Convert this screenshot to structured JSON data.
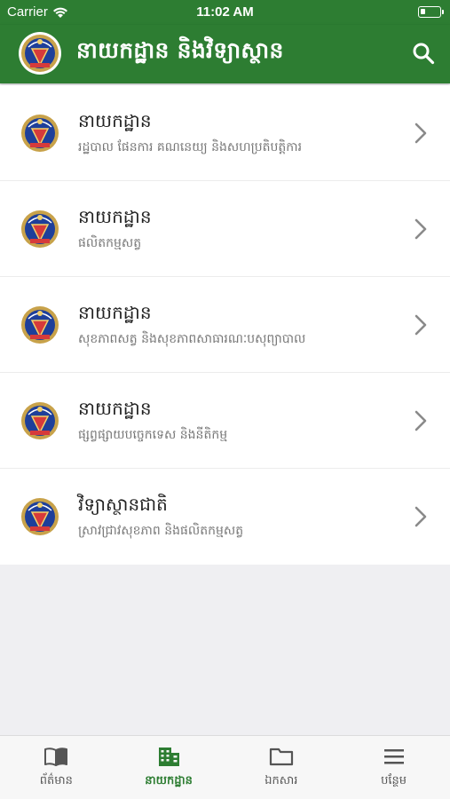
{
  "status_bar": {
    "carrier": "Carrier",
    "time": "11:02 AM"
  },
  "header": {
    "title": "នាយកដ្ឋាន និងវិទ្យាស្ថាន",
    "search_icon": "search-icon"
  },
  "items": [
    {
      "title": "នាយកដ្ឋាន",
      "subtitle": "រដ្ឋបាល ផែនការ គណនេយ្យ និងសហប្រតិបត្តិការ"
    },
    {
      "title": "នាយកដ្ឋាន",
      "subtitle": "ផលិតកម្មសត្វ"
    },
    {
      "title": "នាយកដ្ឋាន",
      "subtitle": "សុខភាពសត្វ និងសុខភាពសាធារណៈបសុព្យាបាល"
    },
    {
      "title": "នាយកដ្ឋាន",
      "subtitle": "ផ្សព្វផ្សាយបច្ចេកទេស និងនីតិកម្ម"
    },
    {
      "title": "វិទ្យាស្ថានជាតិ",
      "subtitle": "ស្រាវជ្រាវសុខភាព និងផលិតកម្មសត្វ"
    }
  ],
  "tabs": [
    {
      "label": "ព័ត៌មាន",
      "icon": "book-icon",
      "active": false
    },
    {
      "label": "នាយកដ្ឋាន",
      "icon": "building-icon",
      "active": true
    },
    {
      "label": "ឯកសារ",
      "icon": "folder-icon",
      "active": false
    },
    {
      "label": "បន្ថែម",
      "icon": "menu-icon",
      "active": false
    }
  ],
  "colors": {
    "primary": "#2d7d32",
    "active_tab": "#2d7d32",
    "inactive_tab": "#555555",
    "background": "#efeff2"
  }
}
